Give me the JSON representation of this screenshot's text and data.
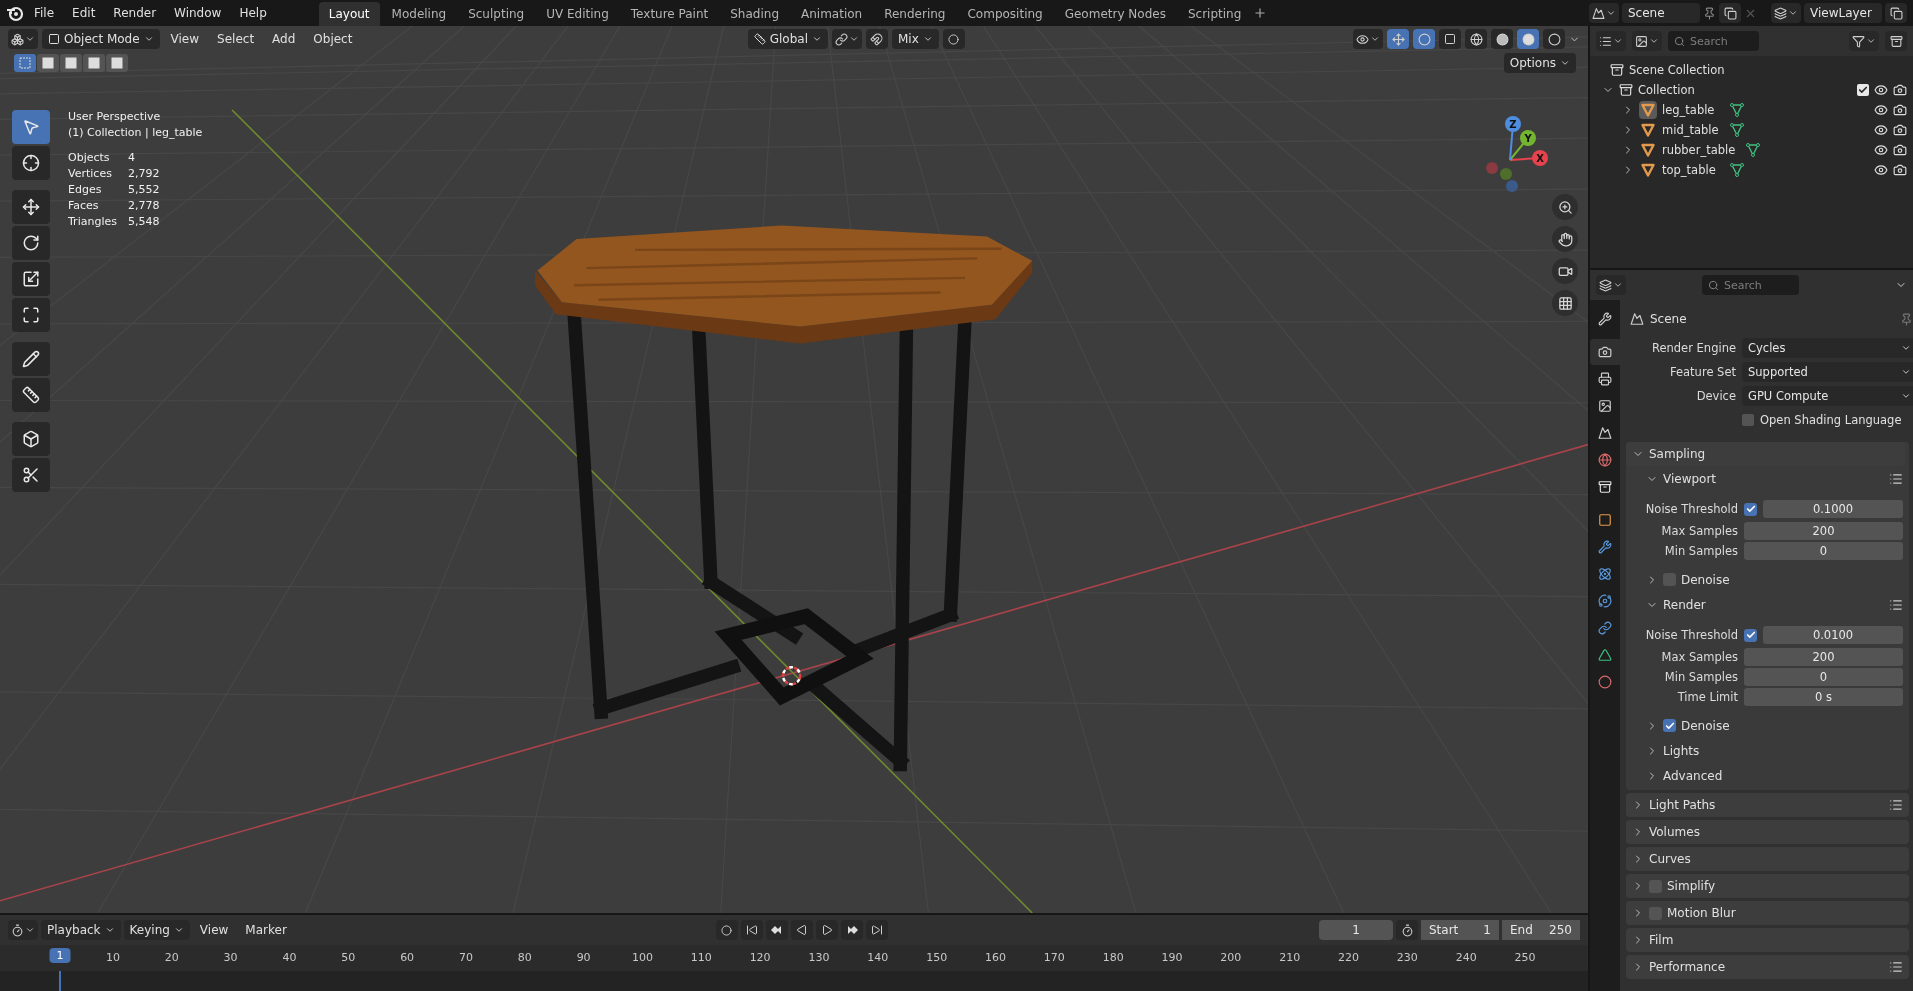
{
  "menu": [
    "File",
    "Edit",
    "Render",
    "Window",
    "Help"
  ],
  "workspaces": [
    {
      "label": "Layout",
      "selected": true
    },
    {
      "label": "Modeling",
      "selected": false
    },
    {
      "label": "Sculpting",
      "selected": false
    },
    {
      "label": "UV Editing",
      "selected": false
    },
    {
      "label": "Texture Paint",
      "selected": false
    },
    {
      "label": "Shading",
      "selected": false
    },
    {
      "label": "Animation",
      "selected": false
    },
    {
      "label": "Rendering",
      "selected": false
    },
    {
      "label": "Compositing",
      "selected": false
    },
    {
      "label": "Geometry Nodes",
      "selected": false
    },
    {
      "label": "Scripting",
      "selected": false
    }
  ],
  "scene": "Scene",
  "view_layer": "ViewLayer",
  "viewport": {
    "mode": "Object Mode",
    "menus": [
      "View",
      "Select",
      "Add",
      "Object"
    ],
    "orientation": "Global",
    "snap": "Mix",
    "options": "Options",
    "select_modes": [
      {
        "selected": true
      },
      {
        "selected": false
      },
      {
        "selected": false
      },
      {
        "selected": false
      },
      {
        "selected": false
      }
    ],
    "tools": [
      {
        "kind": "select",
        "selected": true
      },
      {
        "kind": "cursor",
        "selected": false
      },
      {
        "kind": "move",
        "selected": false
      },
      {
        "kind": "rotate",
        "selected": false
      },
      {
        "kind": "scale",
        "selected": false
      },
      {
        "kind": "transform",
        "selected": false
      },
      {
        "kind": "annotate",
        "selected": false
      },
      {
        "kind": "measure",
        "selected": false
      },
      {
        "kind": "add-cube",
        "selected": false
      },
      {
        "kind": "cut",
        "selected": false
      }
    ],
    "view": "User Perspective",
    "context": "(1) Collection | leg_table",
    "stats": [
      {
        "label": "Objects",
        "value": "4"
      },
      {
        "label": "Vertices",
        "value": "2,792"
      },
      {
        "label": "Edges",
        "value": "5,552"
      },
      {
        "label": "Faces",
        "value": "2,778"
      },
      {
        "label": "Triangles",
        "value": "5,548"
      }
    ],
    "gizmo_axes": [
      "X",
      "Y",
      "Z"
    ]
  },
  "outliner": {
    "search": {
      "placeholder": "Search"
    },
    "root": "Scene Collection",
    "collection": {
      "name": "Collection",
      "expanded": true,
      "checked": true,
      "children": [
        {
          "name": "leg_table",
          "active": true
        },
        {
          "name": "mid_table",
          "active": false
        },
        {
          "name": "rubber_table",
          "active": false
        },
        {
          "name": "top_table",
          "active": false
        }
      ]
    }
  },
  "properties": {
    "search": {
      "placeholder": "Search"
    },
    "tabs": [
      {
        "kind": "tool",
        "selected": false
      },
      {
        "kind": "render",
        "selected": true
      },
      {
        "kind": "output",
        "selected": false
      },
      {
        "kind": "view-layer",
        "selected": false
      },
      {
        "kind": "scene",
        "selected": false
      },
      {
        "kind": "world",
        "selected": false
      },
      {
        "kind": "collection",
        "selected": false
      },
      {
        "kind": "object",
        "selected": false
      },
      {
        "kind": "modifier",
        "selected": false
      },
      {
        "kind": "particles",
        "selected": false
      },
      {
        "kind": "physics",
        "selected": false
      },
      {
        "kind": "constraint",
        "selected": false
      },
      {
        "kind": "data",
        "selected": false
      },
      {
        "kind": "material",
        "selected": false
      }
    ],
    "context": "Scene",
    "fields": [
      {
        "label": "Render Engine",
        "value": "Cycles"
      },
      {
        "label": "Feature Set",
        "value": "Supported"
      },
      {
        "label": "Device",
        "value": "GPU Compute"
      }
    ],
    "osl": {
      "label": "Open Shading Language",
      "checked": false
    },
    "sampling": {
      "title": "Sampling",
      "expanded": true,
      "items": [
        {
          "kind": "subpanel",
          "title": "Viewport",
          "expanded": true,
          "presets": true
        },
        {
          "kind": "toggle-number",
          "label": "Noise Threshold",
          "checked": true,
          "value": "0.1000"
        },
        {
          "kind": "number",
          "label": "Max Samples",
          "value": "200"
        },
        {
          "kind": "number",
          "label": "Min Samples",
          "value": "0"
        },
        {
          "kind": "subpanel-check",
          "title": "Denoise",
          "expanded": false,
          "checked": false
        },
        {
          "kind": "subpanel",
          "title": "Render",
          "expanded": true,
          "presets": true
        },
        {
          "kind": "toggle-number",
          "label": "Noise Threshold",
          "checked": true,
          "value": "0.0100"
        },
        {
          "kind": "number",
          "label": "Max Samples",
          "value": "200"
        },
        {
          "kind": "number",
          "label": "Min Samples",
          "value": "0"
        },
        {
          "kind": "number",
          "label": "Time Limit",
          "value": "0 s"
        },
        {
          "kind": "subpanel-check",
          "title": "Denoise",
          "expanded": false,
          "checked": true
        },
        {
          "kind": "subpanel",
          "title": "Lights",
          "expanded": false,
          "presets": false
        },
        {
          "kind": "subpanel",
          "title": "Advanced",
          "expanded": false,
          "presets": false
        }
      ]
    },
    "panels": [
      {
        "kind": "plain",
        "title": "Light Paths",
        "expanded": false,
        "presets": true
      },
      {
        "kind": "plain",
        "title": "Volumes",
        "expanded": false,
        "presets": false
      },
      {
        "kind": "plain",
        "title": "Curves",
        "expanded": false,
        "presets": false
      },
      {
        "kind": "check",
        "title": "Simplify",
        "expanded": false,
        "checked": false,
        "presets": false
      },
      {
        "kind": "check",
        "title": "Motion Blur",
        "expanded": false,
        "checked": false,
        "presets": false
      },
      {
        "kind": "plain",
        "title": "Film",
        "expanded": false,
        "presets": false
      },
      {
        "kind": "plain",
        "title": "Performance",
        "expanded": false,
        "presets": true
      }
    ]
  },
  "timeline": {
    "menus": [
      {
        "label": "Playback",
        "dropdown": true
      },
      {
        "label": "Keying",
        "dropdown": true
      },
      {
        "label": "View",
        "dropdown": false
      },
      {
        "label": "Marker",
        "dropdown": false
      }
    ],
    "current_frame": "1",
    "start": {
      "label": "Start",
      "value": "1"
    },
    "end": {
      "label": "End",
      "value": "250"
    },
    "playhead": "1",
    "ticks": [
      "10",
      "20",
      "30",
      "40",
      "50",
      "60",
      "70",
      "80",
      "90",
      "100",
      "110",
      "120",
      "130",
      "140",
      "150",
      "160",
      "170",
      "180",
      "190",
      "200",
      "210",
      "220",
      "230",
      "240",
      "250"
    ]
  }
}
